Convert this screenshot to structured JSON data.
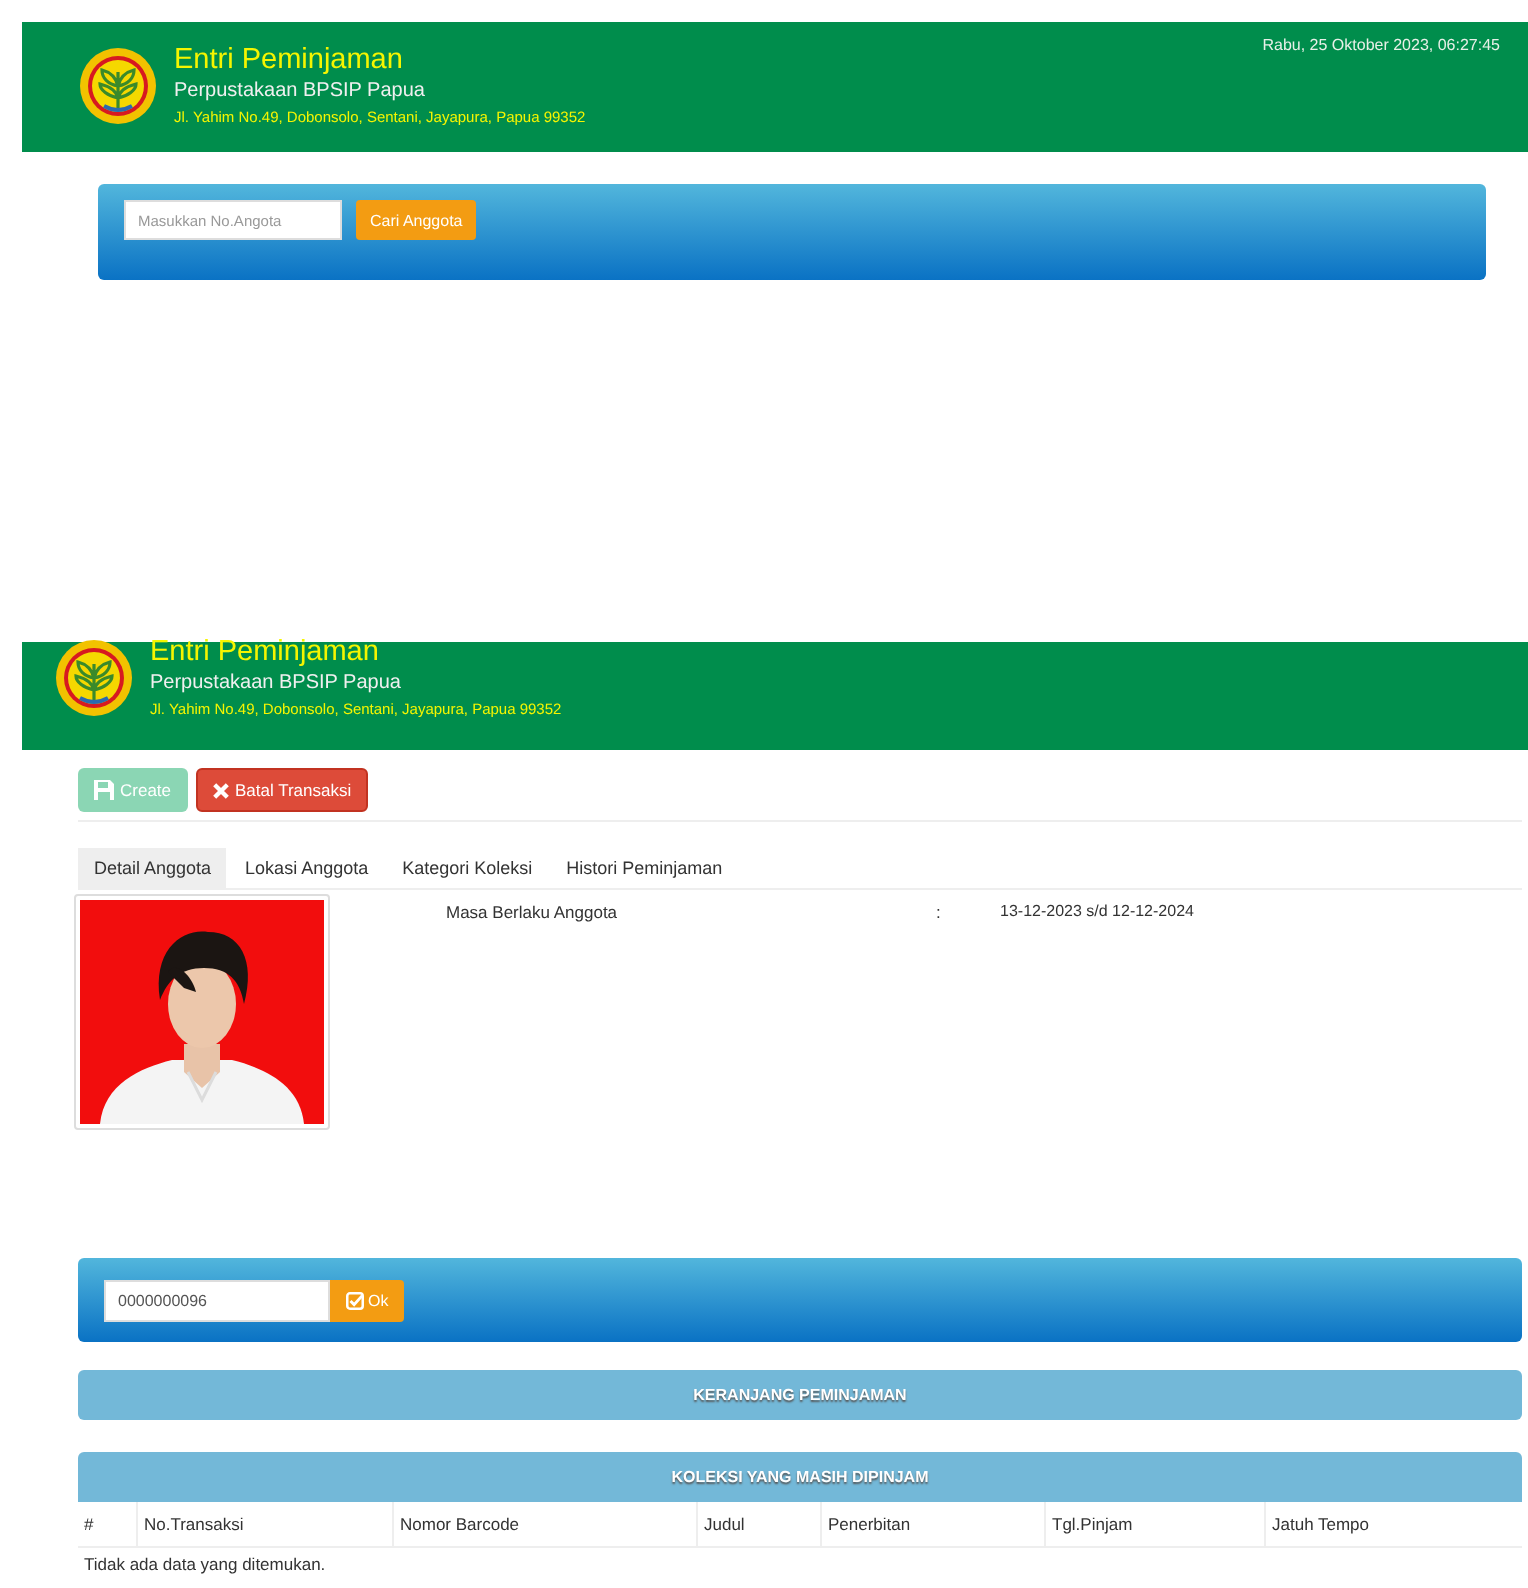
{
  "top_header": {
    "title": "Entri Peminjaman",
    "subtitle": "Perpustakaan BPSIP Papua",
    "address": "Jl. Yahim No.49, Dobonsolo, Sentani, Jayapura, Papua 99352",
    "datetime": "Rabu, 25 Oktober 2023, 06:27:45"
  },
  "member_search": {
    "placeholder": "Masukkan No.Angota",
    "button": "Cari Anggota"
  },
  "second_header": {
    "title": "Entri Peminjaman",
    "subtitle": "Perpustakaan BPSIP Papua",
    "address": "Jl. Yahim No.49, Dobonsolo, Sentani, Jayapura, Papua 99352"
  },
  "toolbar": [
    {
      "label": "Create",
      "kind": "create",
      "disabled": true
    },
    {
      "label": "Batal Transaksi",
      "kind": "cancel",
      "disabled": false
    }
  ],
  "tabs": [
    {
      "label": "Detail Anggota",
      "selected": true
    },
    {
      "label": "Lokasi Anggota",
      "selected": false
    },
    {
      "label": "Kategori Koleksi",
      "selected": false
    },
    {
      "label": "Histori Peminjaman",
      "selected": false
    }
  ],
  "member_detail": {
    "fields": [
      {
        "label": "Masa Berlaku Anggota",
        "separator": ":",
        "value": "13-12-2023 s/d 12-12-2024"
      }
    ]
  },
  "barcode_entry": {
    "value": "0000000096",
    "button": "Ok"
  },
  "cart_panel": {
    "title": "KERANJANG PEMINJAMAN"
  },
  "borrowed_panel": {
    "title": "KOLEKSI YANG MASIH DIPINJAM",
    "columns": [
      "#",
      "No.Transaksi",
      "Nomor Barcode",
      "Judul",
      "Penerbitan",
      "Tgl.Pinjam",
      "Jatuh Tempo"
    ],
    "empty_message": "Tidak ada data yang ditemukan."
  }
}
